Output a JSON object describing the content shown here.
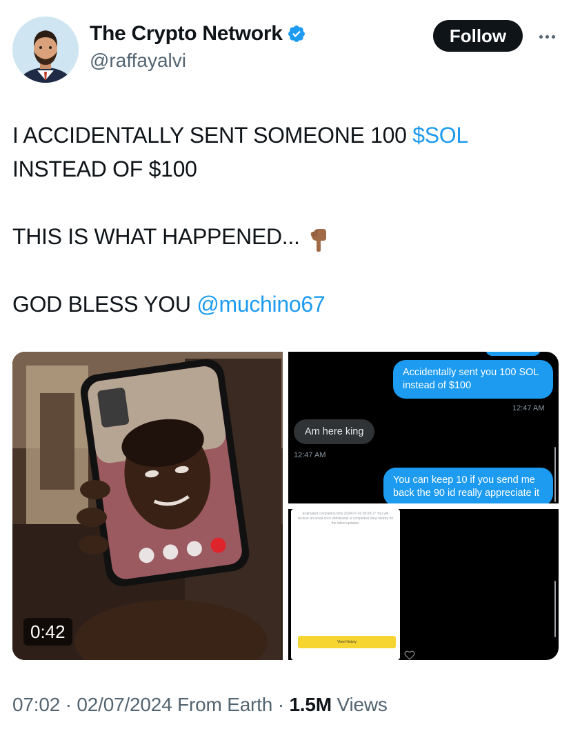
{
  "header": {
    "display_name": "The Crypto Network",
    "handle": "@raffayalvi",
    "follow_label": "Follow",
    "verified_color": "#1d9bf0"
  },
  "tweet": {
    "line1_text": "I ACCIDENTALLY SENT SOMEONE 100 ",
    "line1_link": "$SOL",
    "line2": "INSTEAD OF $100",
    "line3": "THIS IS WHAT HAPPENED...",
    "line3_emoji": "backhand-index-pointing-down",
    "line4_text": "GOD BLESS YOU ",
    "line4_link": "@muchino67",
    "link_color": "#1d9bf0"
  },
  "media": {
    "video": {
      "duration": "0:42"
    },
    "chat": {
      "msg1": "Accidentally sent you 100 SOL instead of $100",
      "time1": "12:47 AM",
      "msg2": "Am here king",
      "time2": "12:47 AM",
      "msg3": "You can keep 10 if you send me back the 90 id really appreciate it"
    },
    "receipt": {
      "text": "Estimated completion time 2024-07-02 06:09:17 You will receive an email once withdrawal is completed View history for the latest updates.",
      "button": "View History"
    }
  },
  "footer": {
    "time": "07:02",
    "date": "02/07/2024",
    "location": "From Earth",
    "views_count": "1.5M",
    "views_label": "Views"
  }
}
